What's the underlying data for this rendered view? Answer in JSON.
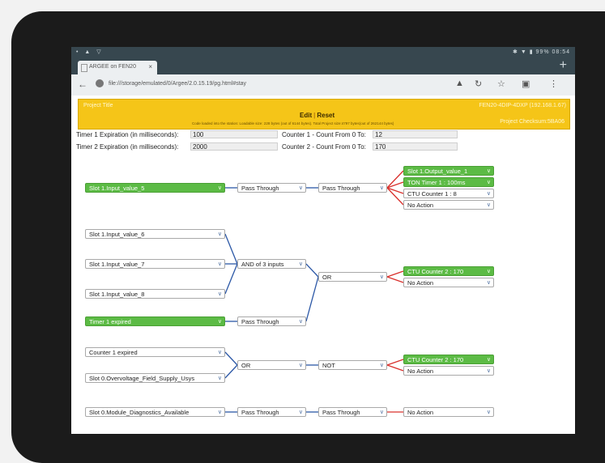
{
  "status_bar": {
    "left_icons": "• ▲ ▽",
    "right_text": "✱ ▼ ▮ 99% 08:54"
  },
  "browser": {
    "tab_title": "ARGEE on FEN20",
    "tab_close": "×",
    "new_tab": "+",
    "url": "file:///storage/emulated/0/Argee/2.0.15.19/pg.html#stay",
    "icons": [
      "back-icon",
      "info-icon",
      "lock-icon",
      "reload-icon",
      "star-icon",
      "tabs-icon",
      "menu-icon"
    ]
  },
  "app_header": {
    "project_title_label": "Project Title",
    "edit_label": "Edit",
    "separator": "|",
    "reset_label": "Reset",
    "status_text": "Code loaded into the station: Loadable size: 228 bytes (out of 6144 bytes). Total Project size:4797 bytes(out of 262144 bytes)",
    "device": "FEN20-4DIP-4DXP  (192.168.1.67)",
    "checksum": "Project Checksum:5BA06"
  },
  "settings": {
    "timer1_label": "Timer 1 Expiration (in milliseconds):",
    "timer1_value": "100",
    "timer2_label": "Timer 2 Expiration (in milliseconds):",
    "timer2_value": "2000",
    "counter1_label": "Counter 1 - Count From 0 To:",
    "counter1_value": "12",
    "counter2_label": "Counter 2 - Count From 0 To:",
    "counter2_value": "170"
  },
  "colors": {
    "accent_green": "#5cbb45",
    "header_yellow": "#f5c518",
    "link_blue": "#2b57a6",
    "link_red": "#d9302c"
  },
  "logic": {
    "rung1": {
      "input": "Slot 1.Input_value_5",
      "op1": "Pass Through",
      "op2": "Pass Through",
      "outputs": [
        "Slot 1.Output_value_1",
        "TON Timer 1 : 100ms",
        "CTU Counter 1 : 8",
        "No Action"
      ]
    },
    "rung2": {
      "inputs": [
        "Slot 1.Input_value_6",
        "Slot 1.Input_value_7",
        "Slot 1.Input_value_8",
        "Timer 1 expired"
      ],
      "and_op": "AND of 3 inputs",
      "pass_op": "Pass Through",
      "or_op": "OR",
      "outputs": [
        "CTU Counter 2 : 170",
        "No Action"
      ]
    },
    "rung3": {
      "inputs": [
        "Counter 1 expired",
        "Slot 0.Overvoltage_Field_Supply_Usys"
      ],
      "or_op": "OR",
      "not_op": "NOT",
      "outputs": [
        "CTU Counter 2 : 170",
        "No Action"
      ]
    },
    "rung4": {
      "input": "Slot 0.Module_Diagnostics_Available",
      "op1": "Pass Through",
      "op2": "Pass Through",
      "output": "No Action"
    }
  }
}
